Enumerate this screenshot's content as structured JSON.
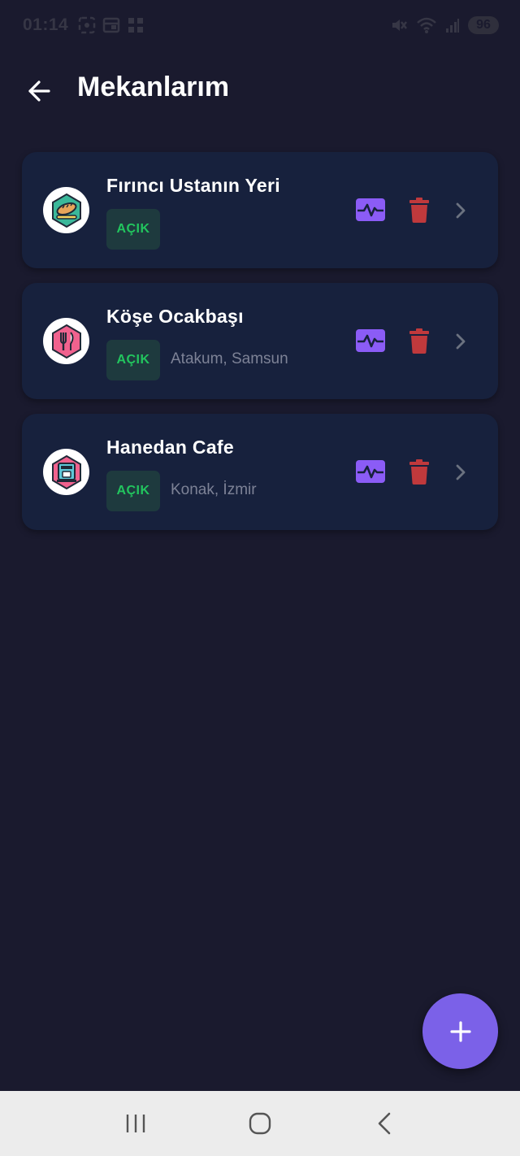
{
  "status_bar": {
    "time": "01:14",
    "battery": "96"
  },
  "header": {
    "title": "Mekanlarım"
  },
  "venues": [
    {
      "name": "Fırıncı Ustanın Yeri",
      "status": "AÇIK",
      "location": "",
      "icon": "bakery-icon"
    },
    {
      "name": "Köşe Ocakbaşı",
      "status": "AÇIK",
      "location": "Atakum, Samsun",
      "icon": "restaurant-icon"
    },
    {
      "name": "Hanedan Cafe",
      "status": "AÇIK",
      "location": "Konak, İzmir",
      "icon": "cafe-icon"
    }
  ],
  "colors": {
    "background": "#1a1a2e",
    "card": "#17213d",
    "accent": "#7b61e8",
    "open_status": "#22c55e",
    "delete": "#c0393c",
    "pulse": "#8b5cf6"
  },
  "fab": {
    "icon": "plus-icon"
  },
  "nav": {
    "recent_icon": "recent-apps-icon",
    "home_icon": "home-icon",
    "back_icon": "back-icon"
  }
}
